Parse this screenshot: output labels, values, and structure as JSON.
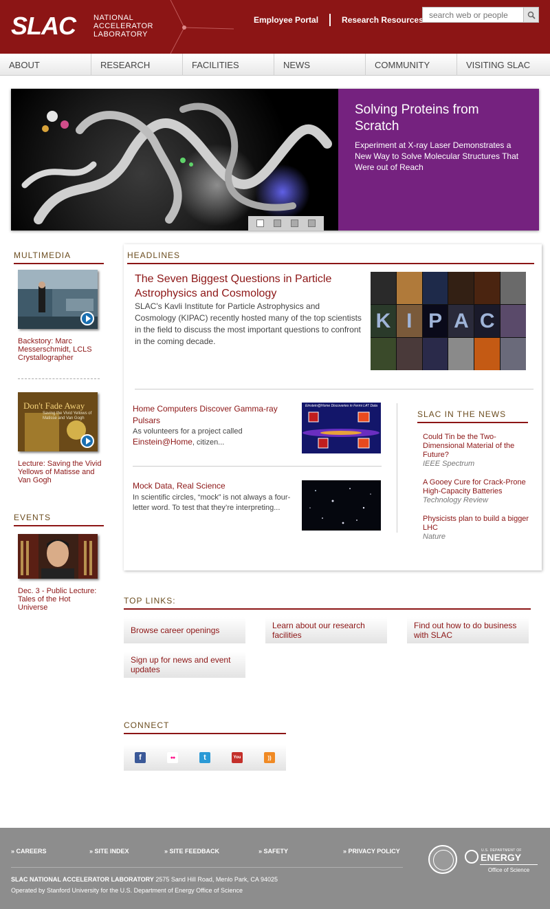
{
  "header": {
    "logo": "SLAC",
    "logo_lines": [
      "NATIONAL",
      "ACCELERATOR",
      "LABORATORY"
    ],
    "links": [
      "Employee Portal",
      "Research Resources"
    ],
    "search_placeholder": "search web or people"
  },
  "nav": [
    "ABOUT",
    "RESEARCH",
    "FACILITIES",
    "NEWS",
    "COMMUNITY",
    "VISITING SLAC"
  ],
  "hero": {
    "title": "Solving Proteins from Scratch",
    "subtitle": "Experiment at X-ray Laser Demonstrates a New Way to Solve Molecular Structures That Were out of Reach",
    "slides": 4,
    "active_slide": 1,
    "panel_color": "#75227f"
  },
  "multimedia": {
    "title": "MULTIMEDIA",
    "items": [
      {
        "caption": "Backstory: Marc Messerschmidt, LCLS Crystallographer"
      },
      {
        "caption": "Lecture: Saving the Vivid Yellows of Matisse and Van Gogh",
        "thumb_title": "Don't Fade Away",
        "thumb_sub": "Saving the Vivid Yellows of Matisse and Van Gogh"
      }
    ]
  },
  "events": {
    "title": "EVENTS",
    "items": [
      {
        "caption": "Dec. 3 - Public Lecture: Tales of the Hot Universe"
      }
    ]
  },
  "headlines": {
    "title": "HEADLINES",
    "lead": {
      "heading": "The Seven Biggest Questions in Particle Astrophysics and Cosmology",
      "body": "SLAC's Kavli Institute for Particle Astrophysics and Cosmology (KIPAC) recently hosted many of the top scientists in the field to discuss the most important questions to confront in the coming decade.",
      "image_letters": [
        "K",
        "I",
        "P",
        "A",
        "C"
      ]
    },
    "stories": [
      {
        "heading": "Home Computers Discover Gamma-ray Pulsars",
        "body_pre": "As volunteers for a project called",
        "body_link": "Einstein@Home",
        "body_post": ", citizen...",
        "img_caption": "Einstein@Home Discoveries in Fermi LAT Data"
      },
      {
        "heading": "Mock Data, Real Science",
        "body": "In scientific circles, “mock” is not always a four-letter word. To test that they’re interpreting..."
      }
    ]
  },
  "in_the_news": {
    "title": "SLAC IN THE NEWS",
    "items": [
      {
        "headline": "Could Tin be the Two-Dimensional Material of the Future?",
        "source": "IEEE Spectrum"
      },
      {
        "headline": "A Gooey Cure for Crack-Prone High-Capacity Batteries",
        "source": "Technology Review"
      },
      {
        "headline": "Physicists plan to build a bigger LHC",
        "source": "Nature"
      }
    ]
  },
  "top_links": {
    "title": "TOP LINKS:",
    "items": [
      "Browse career openings",
      "Learn about our research facilities",
      "Find out how to do business with SLAC",
      "Sign up for news and event updates"
    ]
  },
  "connect": {
    "title": "CONNECT",
    "icons": [
      {
        "name": "facebook-icon",
        "glyph": "f",
        "color": "#3b5998"
      },
      {
        "name": "flickr-icon",
        "glyph": "●●",
        "color": "#ffffff"
      },
      {
        "name": "twitter-icon",
        "glyph": "t",
        "color": "#2b9ad6"
      },
      {
        "name": "youtube-icon",
        "glyph": "You",
        "color": "#c4302b"
      },
      {
        "name": "rss-icon",
        "glyph": "))",
        "color": "#f08a24"
      }
    ]
  },
  "footer": {
    "links": [
      "CAREERS",
      "SITE INDEX",
      "SITE FEEDBACK",
      "SAFETY",
      "PRIVACY POLICY"
    ],
    "address_bold": "SLAC NATIONAL ACCELERATOR LABORATORY",
    "address": "2575 Sand Hill Road, Menlo Park, CA 94025",
    "operated_by": "Operated by Stanford University for the U.S. Department of Energy Office of Science",
    "doe_small": "U.S. DEPARTMENT OF",
    "doe_big": "ENERGY",
    "doe_office": "Office of Science"
  },
  "colors": {
    "brand": "#8c1515",
    "heading": "#6b4c1e",
    "footer": "#8d8d8d"
  }
}
